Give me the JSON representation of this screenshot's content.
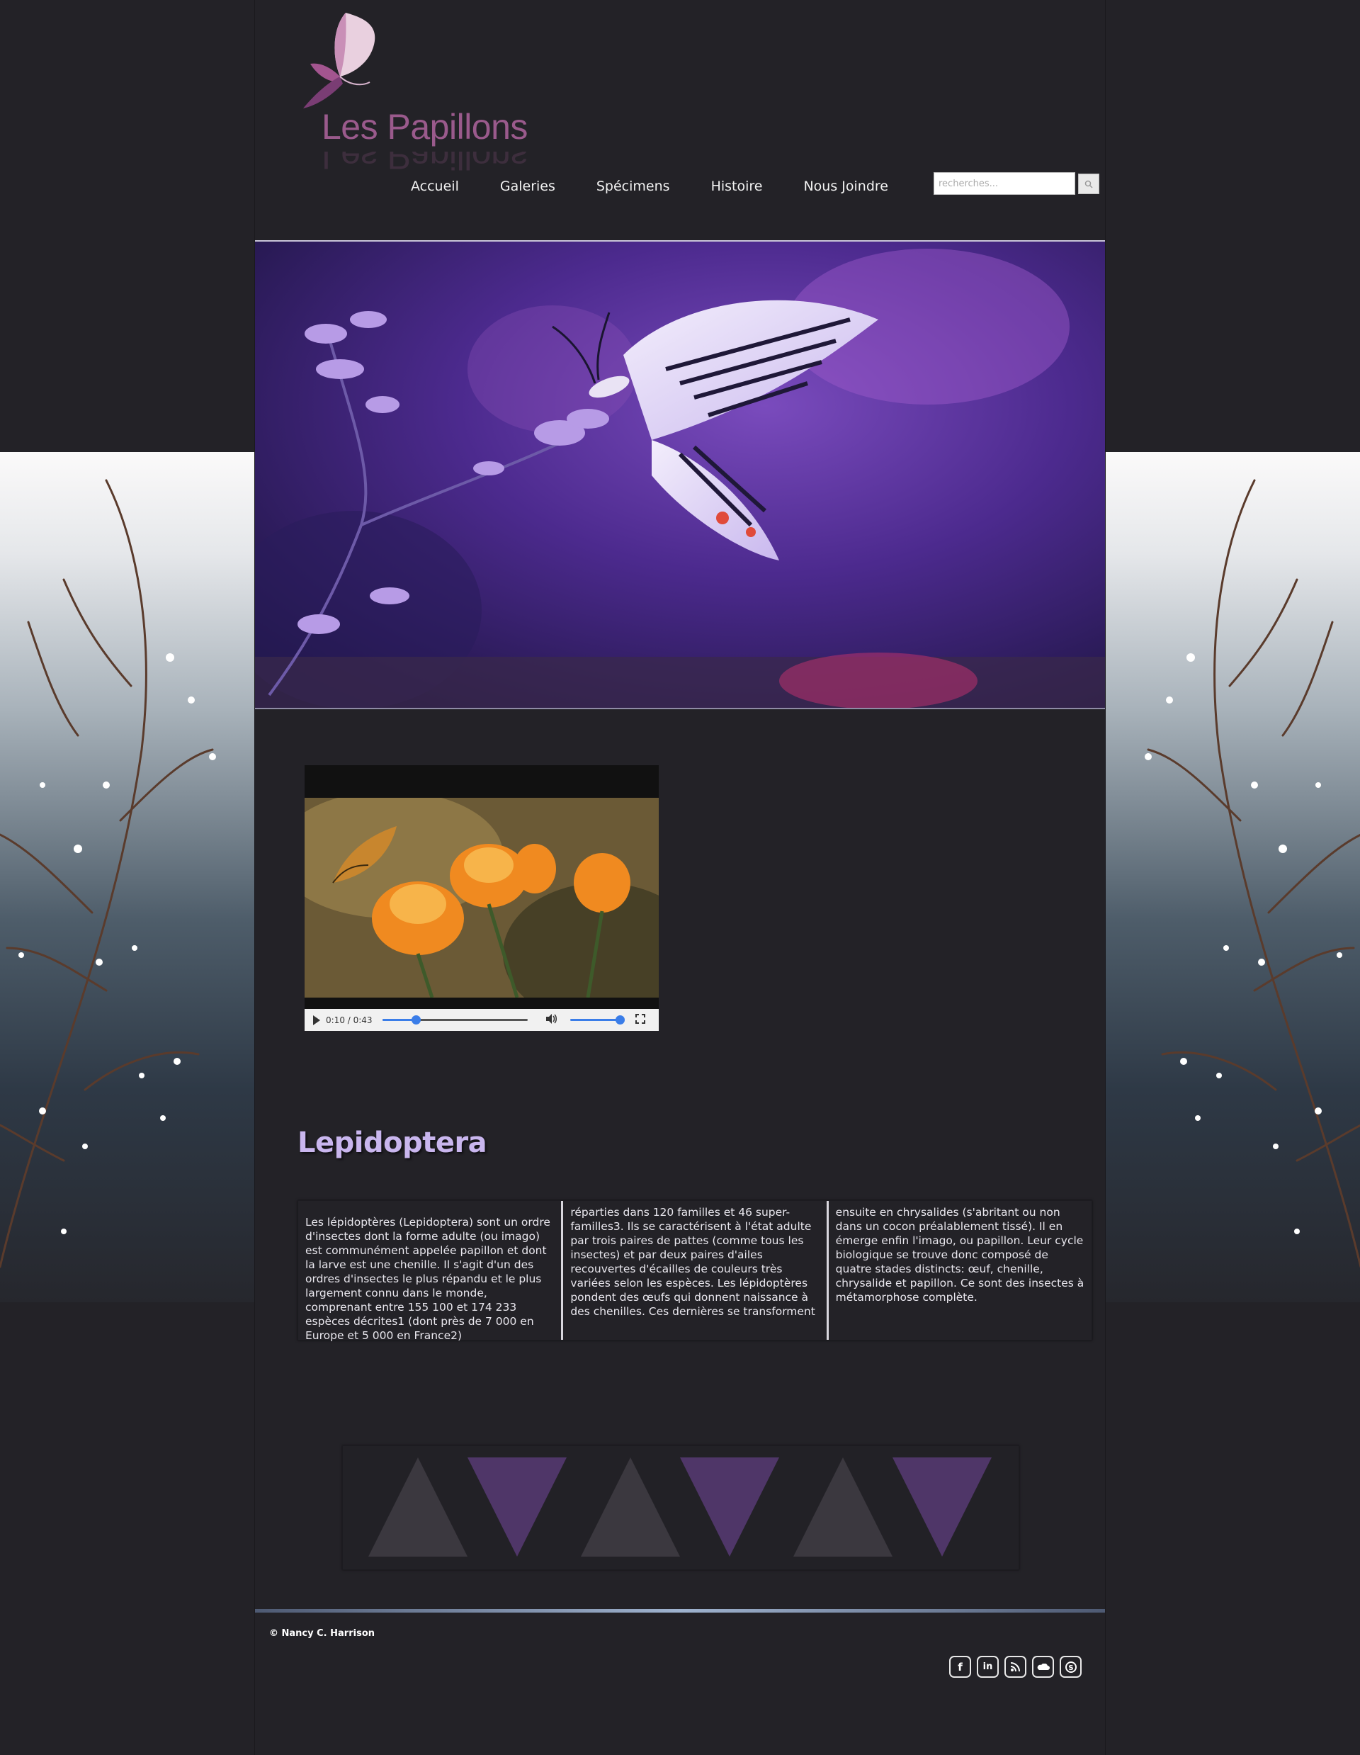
{
  "header": {
    "logo_text": "Les Papillons",
    "search_placeholder": "recherches..."
  },
  "nav": {
    "items": [
      "Accueil",
      "Galeries",
      "Spécimens",
      "Histoire",
      "Nous Joindre"
    ]
  },
  "video": {
    "time": "0:10 / 0:43",
    "progress": 0.23,
    "volume": 1.0
  },
  "article": {
    "heading": "Lepidoptera",
    "columns": [
      "Les lépidoptères (Lepidoptera) sont un ordre d'insectes dont la forme adulte (ou imago) est communément appelée papillon et dont la larve est une chenille. Il s'agit d'un des ordres d'insectes le plus répandu et le plus largement connu dans le monde, comprenant entre 155 100 et 174 233 espèces décrites1 (dont près de 7 000 en Europe et 5 000 en France2)",
      "réparties dans 120 familles et 46 super-familles3. Ils se caractérisent à l'état adulte par trois paires de pattes (comme tous les insectes) et par deux paires d'ailes recouvertes d'écailles de couleurs très variées selon les espèces. Les lépidoptères pondent des œufs qui donnent naissance à des chenilles. Ces dernières se transforment",
      "ensuite en chrysalides (s'abritant ou non dans un cocon préalablement tissé). Il en émerge enfin l'imago, ou papillon. Leur cycle biologique se trouve donc composé de quatre stades distincts: œuf, chenille, chrysalide et papillon. Ce sont des insectes à métamorphose complète."
    ]
  },
  "footer": {
    "copyright": "© Nancy C. Harrison",
    "socials": [
      {
        "icon": "facebook-icon",
        "glyph": "f"
      },
      {
        "icon": "linkedin-icon",
        "glyph": "in"
      },
      {
        "icon": "rss-icon",
        "glyph": ""
      },
      {
        "icon": "soundcloud-icon",
        "glyph": ""
      },
      {
        "icon": "skype-icon",
        "glyph": "S"
      }
    ]
  },
  "colors": {
    "background": "#232227",
    "heading": "#c9b6ee",
    "logo": "#9a5a8c",
    "triangle_gray": "#3b383f",
    "triangle_purple": "#4f3668"
  }
}
